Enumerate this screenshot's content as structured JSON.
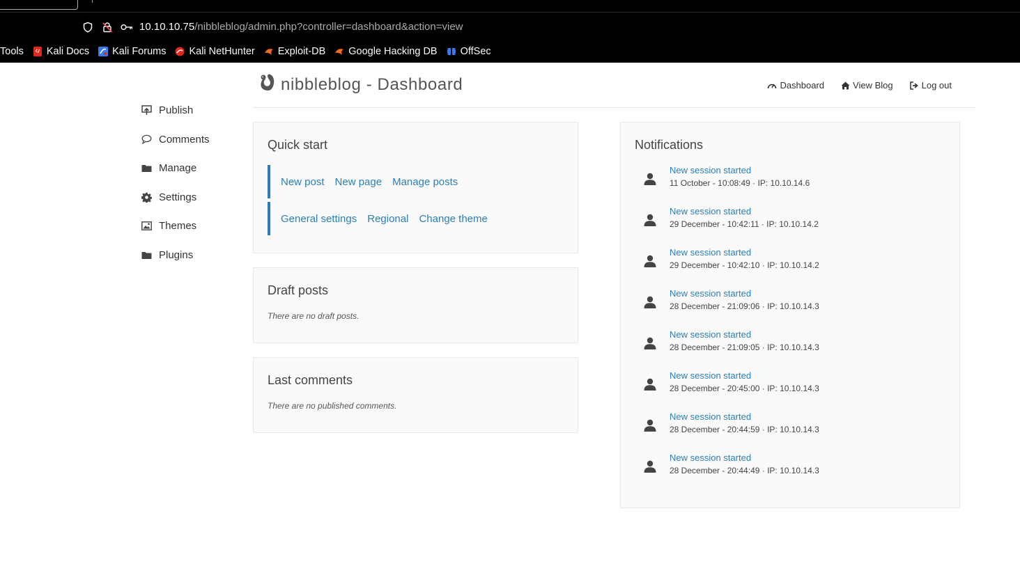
{
  "browser": {
    "url_host": "10.10.10.75",
    "url_path": "/nibbleblog/admin.php?controller=dashboard&action=view",
    "bookmarks": [
      {
        "label": "Tools",
        "icon": "none"
      },
      {
        "label": "Kali Docs",
        "icon": "kali-docs-icon"
      },
      {
        "label": "Kali Forums",
        "icon": "kali-forums-icon"
      },
      {
        "label": "Kali NetHunter",
        "icon": "kali-nethunter-icon"
      },
      {
        "label": "Exploit-DB",
        "icon": "exploit-db-icon"
      },
      {
        "label": "Google Hacking DB",
        "icon": "ghdb-icon"
      },
      {
        "label": "OffSec",
        "icon": "offsec-icon"
      }
    ]
  },
  "header": {
    "title": "nibbleblog - Dashboard",
    "nav": [
      {
        "label": "Dashboard",
        "icon": "gauge-icon"
      },
      {
        "label": "View Blog",
        "icon": "home-icon"
      },
      {
        "label": "Log out",
        "icon": "logout-icon"
      }
    ]
  },
  "sidebar": {
    "items": [
      {
        "label": "Publish",
        "icon": "publish-icon"
      },
      {
        "label": "Comments",
        "icon": "comment-icon"
      },
      {
        "label": "Manage",
        "icon": "folder-icon"
      },
      {
        "label": "Settings",
        "icon": "gear-icon"
      },
      {
        "label": "Themes",
        "icon": "image-icon"
      },
      {
        "label": "Plugins",
        "icon": "folder-icon"
      }
    ]
  },
  "quick_start": {
    "title": "Quick start",
    "row1": [
      "New post",
      "New page",
      "Manage posts"
    ],
    "row2": [
      "General settings",
      "Regional",
      "Change theme"
    ]
  },
  "draft_posts": {
    "title": "Draft posts",
    "empty": "There are no draft posts."
  },
  "last_comments": {
    "title": "Last comments",
    "empty": "There are no published comments."
  },
  "notifications": {
    "title": "Notifications",
    "items": [
      {
        "title": "New session started",
        "meta": "11 October - 10:08:49 · IP: 10.10.14.6"
      },
      {
        "title": "New session started",
        "meta": "29 December - 10:42:11 · IP: 10.10.14.2"
      },
      {
        "title": "New session started",
        "meta": "29 December - 10:42:10 · IP: 10.10.14.2"
      },
      {
        "title": "New session started",
        "meta": "28 December - 21:09:06 · IP: 10.10.14.3"
      },
      {
        "title": "New session started",
        "meta": "28 December - 21:09:05 · IP: 10.10.14.3"
      },
      {
        "title": "New session started",
        "meta": "28 December - 20:45:00 · IP: 10.10.14.3"
      },
      {
        "title": "New session started",
        "meta": "28 December - 20:44:59 · IP: 10.10.14.3"
      },
      {
        "title": "New session started",
        "meta": "28 December - 20:44:49 · IP: 10.10.14.3"
      }
    ]
  },
  "colors": {
    "link": "#2a7fb7",
    "chrome_bg": "#000000",
    "panel_bg": "#fafafa"
  }
}
